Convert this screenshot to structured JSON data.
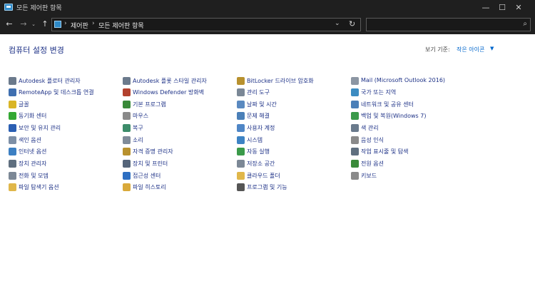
{
  "window": {
    "title": "모든 제어판 항목",
    "minimize": "—",
    "maximize": "☐",
    "close": "✕"
  },
  "nav": {
    "back": "←",
    "forward": "→",
    "recent": "⌄",
    "up": "↑",
    "breadcrumbs": [
      "제어판",
      "모든 제어판 항목"
    ],
    "separator": "›",
    "dropdown": "⌄",
    "refresh": "↻",
    "search_placeholder": "",
    "search_icon": "⌕"
  },
  "header": {
    "title": "컴퓨터 설정 변경",
    "view_by_label": "보기 기준:",
    "view_by_value": "작은 아이콘",
    "view_by_caret": "▼"
  },
  "items": {
    "col1": [
      {
        "label": "Autodesk 플로터 관리자",
        "icon": "plotter-icon",
        "color": "#6b7a8c"
      },
      {
        "label": "RemoteApp 및 데스크톱 연결",
        "icon": "remoteapp-icon",
        "color": "#3f6fb0"
      },
      {
        "label": "글꼴",
        "icon": "font-icon",
        "color": "#d9b526"
      },
      {
        "label": "동기화 센터",
        "icon": "sync-icon",
        "color": "#33a833"
      },
      {
        "label": "보안 및 유지 관리",
        "icon": "flag-icon",
        "color": "#2b5fb3"
      },
      {
        "label": "색인 옵션",
        "icon": "search-index-icon",
        "color": "#7d8fa6"
      },
      {
        "label": "인터넷 옵션",
        "icon": "internet-icon",
        "color": "#3c7fc2"
      },
      {
        "label": "장치 관리자",
        "icon": "device-manager-icon",
        "color": "#5f6f7f"
      },
      {
        "label": "전화 및 모뎀",
        "icon": "modem-icon",
        "color": "#7c8896"
      },
      {
        "label": "파일 탐색기 옵션",
        "icon": "folder-options-icon",
        "color": "#e0b74a"
      }
    ],
    "col2": [
      {
        "label": "Autodesk 플롯 스타일 관리자",
        "icon": "plot-style-icon",
        "color": "#6b7a8c"
      },
      {
        "label": "Windows Defender 방화벽",
        "icon": "firewall-icon",
        "color": "#b3412e"
      },
      {
        "label": "기본 프로그램",
        "icon": "default-programs-icon",
        "color": "#3a8a3a"
      },
      {
        "label": "마우스",
        "icon": "mouse-icon",
        "color": "#8a8a8a"
      },
      {
        "label": "복구",
        "icon": "recovery-icon",
        "color": "#3c8c6a"
      },
      {
        "label": "소리",
        "icon": "speaker-icon",
        "color": "#7f8b99"
      },
      {
        "label": "자격 증명 관리자",
        "icon": "credential-icon",
        "color": "#b8912e"
      },
      {
        "label": "장치 및 프린터",
        "icon": "printer-icon",
        "color": "#55657a"
      },
      {
        "label": "접근성 센터",
        "icon": "accessibility-icon",
        "color": "#2e6fc2"
      },
      {
        "label": "파일 히스토리",
        "icon": "file-history-icon",
        "color": "#d9a93a"
      }
    ],
    "col3": [
      {
        "label": "BitLocker 드라이브 암호화",
        "icon": "bitlocker-icon",
        "color": "#b8912e"
      },
      {
        "label": "관리 도구",
        "icon": "admin-tools-icon",
        "color": "#7a8796"
      },
      {
        "label": "날짜 및 시간",
        "icon": "clock-icon",
        "color": "#5a89c0"
      },
      {
        "label": "문제 해결",
        "icon": "troubleshoot-icon",
        "color": "#4a7fb8"
      },
      {
        "label": "사용자 계정",
        "icon": "user-accounts-icon",
        "color": "#4f86c6"
      },
      {
        "label": "시스템",
        "icon": "system-icon",
        "color": "#3d83c4"
      },
      {
        "label": "자동 실행",
        "icon": "autoplay-icon",
        "color": "#3a9a4a"
      },
      {
        "label": "저장소 공간",
        "icon": "storage-icon",
        "color": "#7c8896"
      },
      {
        "label": "클라우드 폴더",
        "icon": "cloud-folder-icon",
        "color": "#e0b74a"
      },
      {
        "label": "프로그램 및 기능",
        "icon": "programs-icon",
        "color": "#555555"
      }
    ],
    "col4": [
      {
        "label": "Mail (Microsoft Outlook 2016)",
        "icon": "mail-icon",
        "color": "#8c96a3"
      },
      {
        "label": "국가 또는 지역",
        "icon": "region-icon",
        "color": "#3c8cc2"
      },
      {
        "label": "네트워크 및 공유 센터",
        "icon": "network-icon",
        "color": "#4a7fb8"
      },
      {
        "label": "백업 및 복원(Windows 7)",
        "icon": "backup-icon",
        "color": "#3a9a4a"
      },
      {
        "label": "색 관리",
        "icon": "color-management-icon",
        "color": "#6a7a8c"
      },
      {
        "label": "음성 인식",
        "icon": "microphone-icon",
        "color": "#8a8a8a"
      },
      {
        "label": "작업 표시줄 및 탐색",
        "icon": "taskbar-icon",
        "color": "#5f6f7f"
      },
      {
        "label": "전원 옵션",
        "icon": "power-icon",
        "color": "#3a8a3a"
      },
      {
        "label": "키보드",
        "icon": "keyboard-icon",
        "color": "#8a8a8a"
      }
    ]
  }
}
